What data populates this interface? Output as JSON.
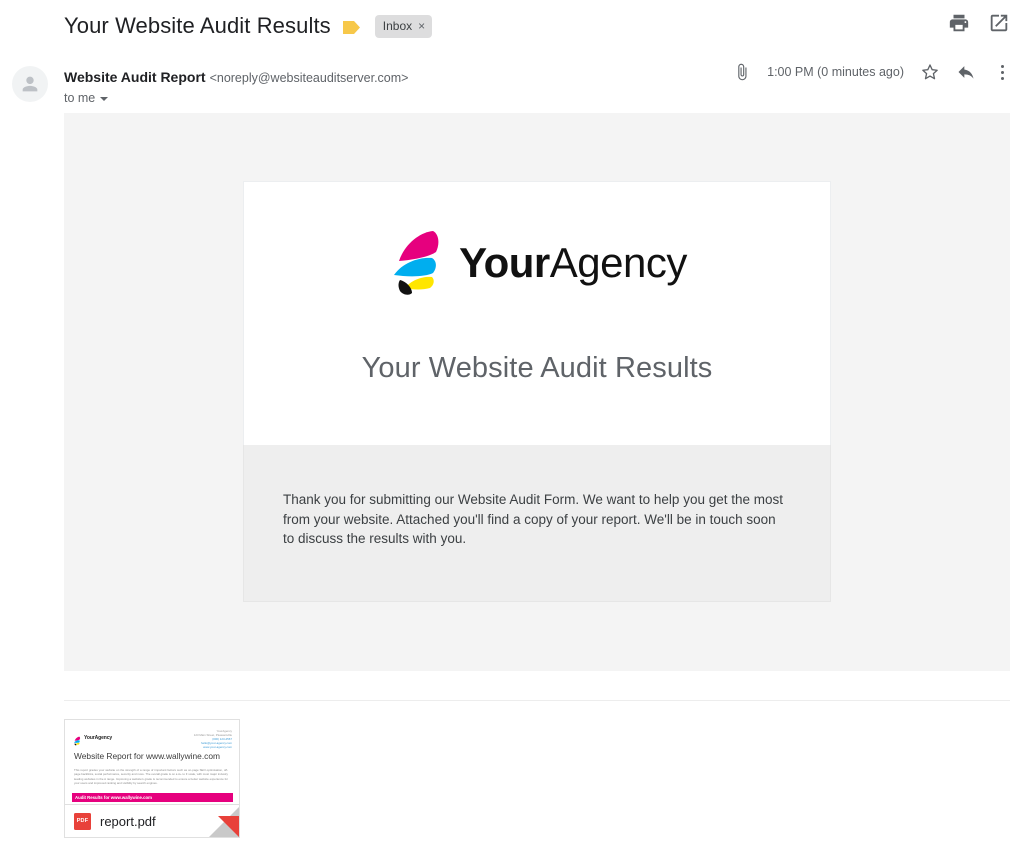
{
  "header": {
    "subject": "Your Website Audit Results",
    "important_marker_icon": "important-arrow-icon",
    "label": "Inbox",
    "label_remove": "×",
    "print_icon": "print-icon",
    "open_new_window_icon": "open-in-new-window-icon"
  },
  "message": {
    "avatar_icon": "person-avatar-icon",
    "sender_name": "Website Audit Report",
    "sender_email": "<noreply@websiteauditserver.com>",
    "recipient": "to me",
    "recipient_caret_icon": "caret-down-icon",
    "attachment_clip_icon": "paperclip-icon",
    "timestamp": "1:00 PM (0 minutes ago)",
    "star_icon": "star-icon",
    "reply_icon": "reply-arrow-icon",
    "more_icon": "kebab-more-icon"
  },
  "email_content": {
    "logo_mark_icon": "youragency-feather-logo-icon",
    "logo_text_bold": "Your",
    "logo_text_light": "Agency",
    "heading": "Your Website Audit Results",
    "paragraph": "Thank you for submitting our Website Audit Form. We want to help you get the most from your website. Attached you'll find a copy of your report. We'll be in touch soon to discuss the results with you."
  },
  "attachment": {
    "file_name": "report.pdf",
    "file_type_badge": "PDF",
    "thumbnail": {
      "logo_text": "YourAgency",
      "logo_mark_icon": "youragency-feather-logo-icon",
      "address_lines": [
        "YourAgency",
        "123 Main Street, Pleasantville",
        "(000) 123-4567",
        "hello@your-agency.com",
        "www.your-agency.com"
      ],
      "title": "Website Report for www.wallywine.com",
      "paragraph": "This report grades your website on the strength of a range of important factors such as on-page SEO optimisation, off-page backlinks, social performance, security and more. The overall grade is on a A+ to F scale, with most major industry leading websites in the A range. Improving a website's grade is recommended to ensure a better website experience for your users and improved ranking and visibility by search engines.",
      "banner": "Audit Results for www.wallywine.com"
    }
  },
  "colors": {
    "brand_magenta": "#e6007e",
    "brand_cyan": "#00aeef",
    "brand_yellow": "#ffe600",
    "pdf_red": "#e8413a",
    "body_background": "#f4f4f4",
    "inner_panel": "#eeeeee",
    "label_chip": "#ddddde",
    "important_yellow": "#f7c84a"
  }
}
